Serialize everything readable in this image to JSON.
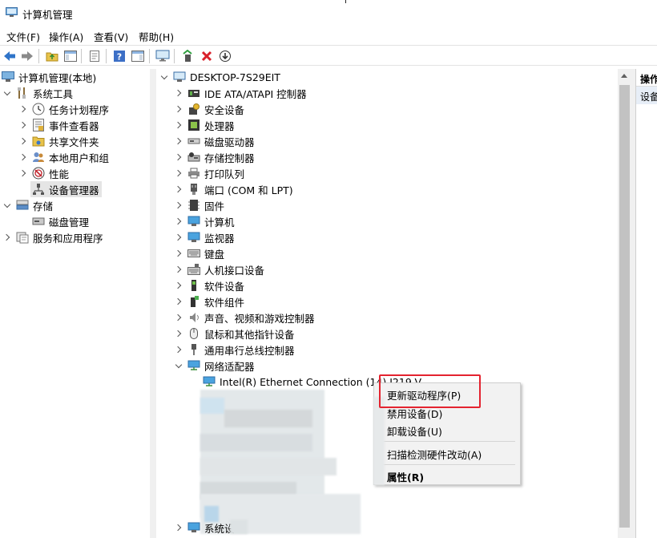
{
  "window": {
    "title": "计算机管理"
  },
  "menubar": {
    "items": [
      "文件(F)",
      "操作(A)",
      "查看(V)",
      "帮助(H)"
    ]
  },
  "left_tree": {
    "root": "计算机管理(本地)",
    "system_tools": "系统工具",
    "task_scheduler": "任务计划程序",
    "event_viewer": "事件查看器",
    "shared_folders": "共享文件夹",
    "local_users": "本地用户和组",
    "performance": "性能",
    "device_manager": "设备管理器",
    "storage": "存储",
    "disk_management": "磁盘管理",
    "services_apps": "服务和应用程序"
  },
  "main_tree": {
    "computer_name": "DESKTOP-7S29EIT",
    "categories": [
      "IDE ATA/ATAPI 控制器",
      "安全设备",
      "处理器",
      "磁盘驱动器",
      "存储控制器",
      "打印队列",
      "端口 (COM 和 LPT)",
      "固件",
      "计算机",
      "监视器",
      "键盘",
      "人机接口设备",
      "软件设备",
      "软件组件",
      "声音、视频和游戏控制器",
      "鼠标和其他指针设备",
      "通用串行总线控制器",
      "网络适配器"
    ],
    "adapter": "Intel(R) Ethernet Connection (14) I219-V",
    "bottom_partial": "系统设"
  },
  "actions_pane": {
    "header": "操作",
    "row": "设备"
  },
  "context_menu": {
    "update_driver": "更新驱动程序(P)",
    "disable_device": "禁用设备(D)",
    "uninstall_device": "卸载设备(U)",
    "scan_changes": "扫描检测硬件改动(A)",
    "properties": "属性(R)"
  },
  "colors": {
    "highlight_box": "#e4232f",
    "selection": "#e5e5e5",
    "menu_bg": "#f2f2f2"
  }
}
